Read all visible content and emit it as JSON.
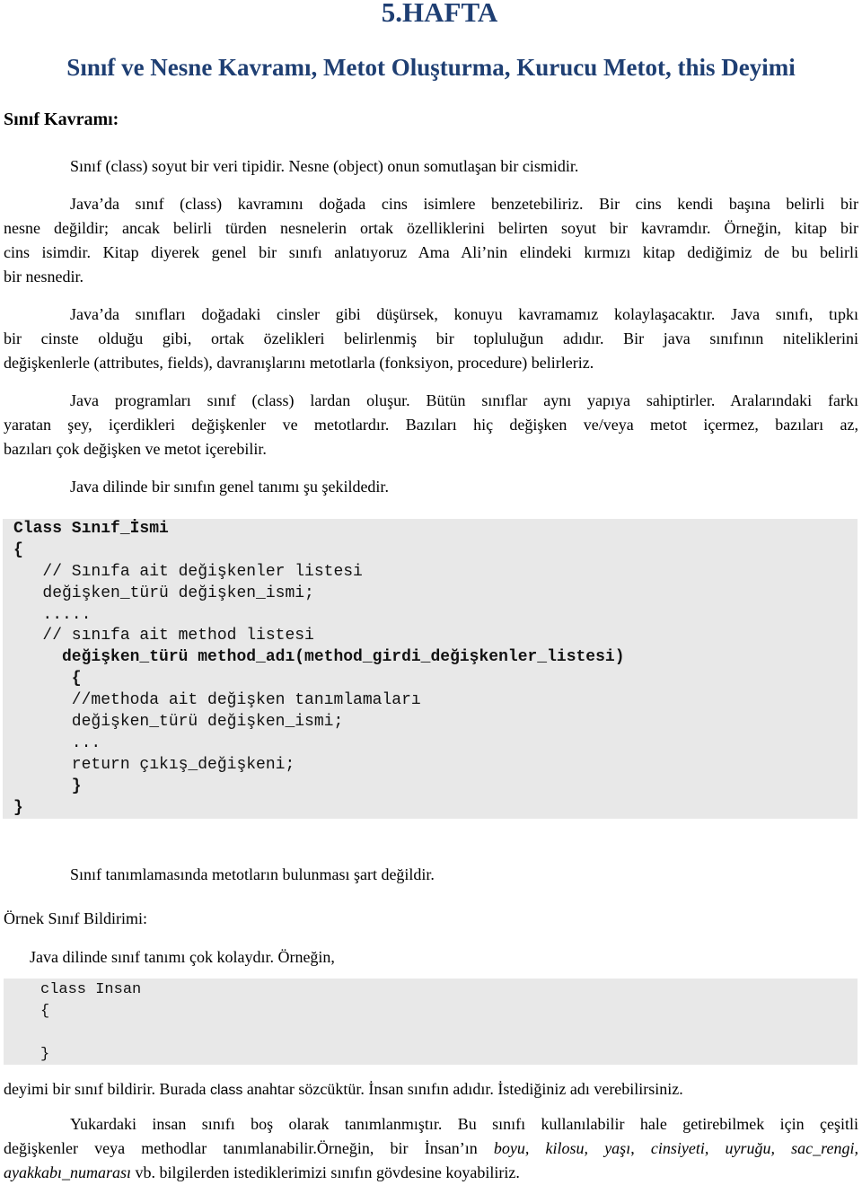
{
  "document": {
    "title": "5.HAFTA",
    "subtitle": "Sınıf ve Nesne Kavramı, Metot Oluşturma, Kurucu Metot, this Deyimi",
    "section_heading": "Sınıf Kavramı:",
    "paragraphs": {
      "p1": "Sınıf (class) soyut bir veri tipidir. Nesne (object) onun somutlaşan bir cismidir.",
      "p2_lines": [
        "Java’da sınıf (class) kavramını doğada cins isimlere benzetebiliriz. Bir cins kendi başına belirli bir",
        "nesne değildir; ancak belirli türden nesnelerin ortak özelliklerini belirten soyut bir kavramdır. Örneğin, kitap bir",
        "cins isimdir. Kitap diyerek genel bir sınıfı anlatıyoruz Ama Ali’nin elindeki kırmızı kitap dediğimiz de bu belirli",
        "bir nesnedir."
      ],
      "p3_lines": [
        "Java’da sınıfları doğadaki cinsler gibi düşürsek, konuyu kavramamız kolaylaşacaktır. Java sınıfı, tıpkı",
        "bir cinste olduğu gibi, ortak özelikleri belirlenmiş bir topluluğun adıdır. Bir java sınıfının niteliklerini",
        "değişkenlerle (attributes, fields), davranışlarını metotlarla (fonksiyon, procedure) belirleriz."
      ],
      "p4_lines": [
        "Java programları sınıf (class) lardan oluşur. Bütün sınıflar aynı yapıya sahiptirler. Aralarındaki farkı",
        "yaratan şey, içerdikleri değişkenler ve metotlardır. Bazıları hiç değişken ve/veya metot içermez, bazıları az,",
        "bazıları çok değişken ve  metot içerebilir."
      ],
      "p5": "Java dilinde bir sınıfın genel tanımı şu şekildedir.",
      "p6": "Sınıf tanımlamasında metotların bulunması şart değildir.",
      "example_heading": "Örnek Sınıf Bildirimi:",
      "p7": "Java dilinde sınıf tanımı çok kolaydır. Örneğin,",
      "p8": {
        "before": "deyimi bir sınıf bildirir. Burada ",
        "keyword": "class",
        "after": " anahtar sözcüktür. İnsan sınıfın adıdır. İstediğiniz adı verebilirsiniz."
      },
      "p9": {
        "line1": "Yukardaki insan sınıfı boş olarak tanımlanmıştır. Bu sınıfı kullanılabilir hale getirebilmek için çeşitli",
        "line2_pre": "değişkenler veya methodlar tanımlanabilir.Örneğin, bir İnsan’ın ",
        "line2_italic": "boyu, kilosu, yaşı",
        "line2_comma": ", ",
        "line2_italic2": "cinsiyeti, uyruğu, sac_rengi,",
        "line3_italic": "ayakkabı_numarası",
        "line3_post": " vb. bilgilerden istediklerimizi sınıfın gövdesine koyabiliriz."
      }
    },
    "code_block_1": [
      {
        "text": "Class Sınıf_İsmi",
        "bold": true
      },
      {
        "text": "{",
        "bold": true
      },
      {
        "text": "   // Sınıfa ait değişkenler listesi",
        "bold": false
      },
      {
        "text": "   değişken_türü değişken_ismi;",
        "bold": false
      },
      {
        "text": "   .....",
        "bold": false
      },
      {
        "text": "   // sınıfa ait method listesi",
        "bold": false
      },
      {
        "text": "     değişken_türü method_adı(method_girdi_değişkenler_listesi)",
        "bold": true
      },
      {
        "text": "      {",
        "bold": true
      },
      {
        "text": "      //methoda ait değişken tanımlamaları",
        "bold": false
      },
      {
        "text": "      değişken_türü değişken_ismi;",
        "bold": false
      },
      {
        "text": "      ...",
        "bold": false
      },
      {
        "text": "      return çıkış_değişkeni;",
        "bold": false
      },
      {
        "text": "      }",
        "bold": true
      },
      {
        "text": "}",
        "bold": true
      }
    ],
    "code_block_2": [
      "class Insan",
      "{",
      "",
      "}"
    ]
  }
}
